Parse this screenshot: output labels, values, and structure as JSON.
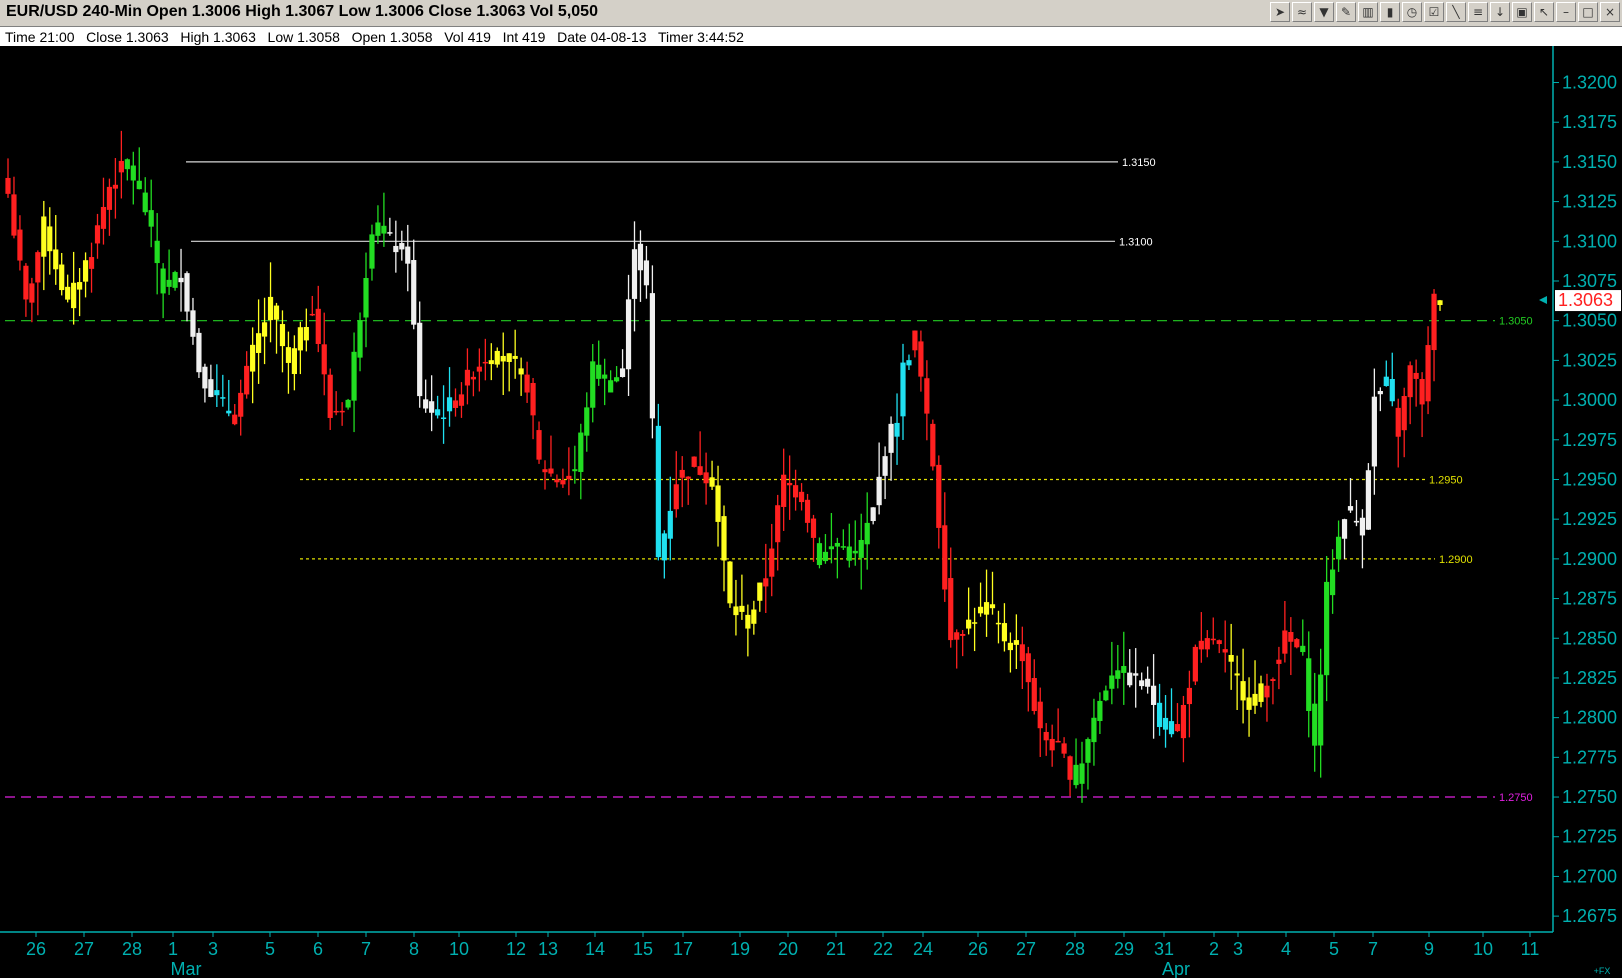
{
  "window": {
    "title": "EUR/USD 240-Min Open 1.3006 High 1.3067 Low 1.3006 Close 1.3063 Vol 5,050",
    "toolbar_icons": [
      "cursor-icon",
      "studies-icon",
      "indicator-icon",
      "draw-icon",
      "bar-chart-icon",
      "candle-icon",
      "clock-icon",
      "settings-icon",
      "pen-icon",
      "trendline-icon",
      "arrow-down-icon",
      "trash-icon",
      "pointer-icon",
      "minimize-icon",
      "restore-icon",
      "close-icon"
    ]
  },
  "infobar": {
    "text": "Time 21:00   Close 1.3063   High 1.3063   Low 1.3058   Open 1.3058   Vol 419   Int 419   Date 04-08-13   Timer 3:44:52"
  },
  "colors": {
    "background": "#000000",
    "axis": "#00b0b0",
    "down": "#ff2020",
    "up": "#22dd22",
    "yellow": "#ffff20",
    "white": "#f0f0f0",
    "cyan": "#20e0f0",
    "green_level": "#22cc22",
    "yellow_level": "#e0e000",
    "magenta_level": "#e020e0",
    "last_price": "#ff2020"
  },
  "chart_data": {
    "type": "candlestick",
    "symbol": "EUR/USD",
    "interval": "240-Min",
    "ylim": [
      1.2665,
      1.3223
    ],
    "y_ticks": [
      "1.3200",
      "1.3175",
      "1.3150",
      "1.3125",
      "1.3100",
      "1.3075",
      "1.3050",
      "1.3025",
      "1.3000",
      "1.2975",
      "1.2950",
      "1.2925",
      "1.2900",
      "1.2875",
      "1.2850",
      "1.2825",
      "1.2800",
      "1.2775",
      "1.2750",
      "1.2725",
      "1.2700",
      "1.2675"
    ],
    "x_day_labels": [
      "26",
      "27",
      "28",
      "1",
      "3",
      "5",
      "6",
      "7",
      "8",
      "10",
      "12",
      "13",
      "14",
      "15",
      "17",
      "19",
      "20",
      "21",
      "22",
      "24",
      "26",
      "27",
      "28",
      "29",
      "31",
      "2",
      "3",
      "4",
      "5",
      "7",
      "9",
      "10",
      "11"
    ],
    "month_labels": [
      "Mar",
      "Apr"
    ],
    "last_price": "1.3063",
    "corner_label": "+FX",
    "levels": [
      {
        "label": "1.3150",
        "value": 1.315,
        "style": "solid",
        "color": "#d8d8d8",
        "label_color": "#ffffff"
      },
      {
        "label": "1.3100",
        "value": 1.31,
        "style": "solid",
        "color": "#d8d8d8",
        "label_color": "#ffffff"
      },
      {
        "label": "1.3050",
        "value": 1.305,
        "style": "dashed",
        "color": "#22cc22",
        "label_color": "#22cc22"
      },
      {
        "label": "1.2950",
        "value": 1.295,
        "style": "dotted",
        "color": "#e0e000",
        "label_color": "#e0e000"
      },
      {
        "label": "1.2900",
        "value": 1.29,
        "style": "dotted",
        "color": "#e0e000",
        "label_color": "#e0e000"
      },
      {
        "label": "1.2750",
        "value": 1.275,
        "style": "dashed",
        "color": "#e020e0",
        "label_color": "#e020e0"
      }
    ],
    "waypoints": [
      [
        0,
        1.313,
        "r"
      ],
      [
        3,
        1.306,
        "r"
      ],
      [
        6,
        1.311,
        "y"
      ],
      [
        10,
        1.306,
        "y"
      ],
      [
        14,
        1.3095,
        "r"
      ],
      [
        17,
        1.3135,
        "r"
      ],
      [
        20,
        1.315,
        "g"
      ],
      [
        23,
        1.312,
        "g"
      ],
      [
        26,
        1.307,
        "g"
      ],
      [
        29,
        1.308,
        "w"
      ],
      [
        32,
        1.302,
        "w"
      ],
      [
        35,
        1.3,
        "c"
      ],
      [
        38,
        1.299,
        "r"
      ],
      [
        41,
        1.303,
        "y"
      ],
      [
        44,
        1.306,
        "y"
      ],
      [
        47,
        1.302,
        "y"
      ],
      [
        51,
        1.306,
        "r"
      ],
      [
        54,
        1.299,
        "r"
      ],
      [
        57,
        1.3,
        "g"
      ],
      [
        61,
        1.311,
        "g"
      ],
      [
        64,
        1.31,
        "w"
      ],
      [
        67,
        1.309,
        "w"
      ],
      [
        69,
        1.3,
        "w"
      ],
      [
        72,
        1.299,
        "c"
      ],
      [
        75,
        1.3,
        "r"
      ],
      [
        78,
        1.302,
        "r"
      ],
      [
        81,
        1.303,
        "y"
      ],
      [
        84,
        1.3025,
        "y"
      ],
      [
        87,
        1.301,
        "r"
      ],
      [
        89,
        1.296,
        "r"
      ],
      [
        92,
        1.295,
        "r"
      ],
      [
        95,
        1.2955,
        "g"
      ],
      [
        98,
        1.302,
        "g"
      ],
      [
        101,
        1.301,
        "g"
      ],
      [
        103,
        1.302,
        "w"
      ],
      [
        105,
        1.31,
        "w"
      ],
      [
        107,
        1.307,
        "w"
      ],
      [
        109,
        1.29,
        "c"
      ],
      [
        112,
        1.295,
        "r"
      ],
      [
        115,
        1.296,
        "r"
      ],
      [
        118,
        1.295,
        "y"
      ],
      [
        121,
        1.287,
        "y"
      ],
      [
        124,
        1.286,
        "y"
      ],
      [
        127,
        1.289,
        "r"
      ],
      [
        130,
        1.295,
        "r"
      ],
      [
        133,
        1.294,
        "r"
      ],
      [
        136,
        1.29,
        "g"
      ],
      [
        139,
        1.291,
        "g"
      ],
      [
        142,
        1.29,
        "g"
      ],
      [
        145,
        1.293,
        "w"
      ],
      [
        147,
        1.297,
        "w"
      ],
      [
        149,
        1.299,
        "c"
      ],
      [
        150,
        1.302,
        "c"
      ],
      [
        152,
        1.304,
        "r"
      ],
      [
        155,
        1.296,
        "r"
      ],
      [
        158,
        1.285,
        "r"
      ],
      [
        161,
        1.286,
        "y"
      ],
      [
        164,
        1.287,
        "y"
      ],
      [
        167,
        1.285,
        "y"
      ],
      [
        170,
        1.284,
        "r"
      ],
      [
        173,
        1.279,
        "r"
      ],
      [
        176,
        1.278,
        "r"
      ],
      [
        179,
        1.276,
        "g"
      ],
      [
        182,
        1.28,
        "g"
      ],
      [
        185,
        1.283,
        "g"
      ],
      [
        188,
        1.2825,
        "w"
      ],
      [
        191,
        1.282,
        "w"
      ],
      [
        193,
        1.28,
        "c"
      ],
      [
        196,
        1.279,
        "r"
      ],
      [
        199,
        1.284,
        "r"
      ],
      [
        202,
        1.285,
        "r"
      ],
      [
        205,
        1.283,
        "y"
      ],
      [
        208,
        1.281,
        "y"
      ],
      [
        211,
        1.282,
        "r"
      ],
      [
        214,
        1.285,
        "r"
      ],
      [
        217,
        1.284,
        "g"
      ],
      [
        219,
        1.278,
        "g"
      ],
      [
        221,
        1.288,
        "g"
      ],
      [
        224,
        1.293,
        "w"
      ],
      [
        227,
        1.292,
        "w"
      ],
      [
        229,
        1.3,
        "w"
      ],
      [
        231,
        1.301,
        "c"
      ],
      [
        233,
        1.298,
        "r"
      ],
      [
        235,
        1.302,
        "r"
      ],
      [
        237,
        1.3,
        "r"
      ],
      [
        239,
        1.3063,
        "r"
      ],
      [
        240,
        1.3063,
        "y"
      ]
    ]
  }
}
